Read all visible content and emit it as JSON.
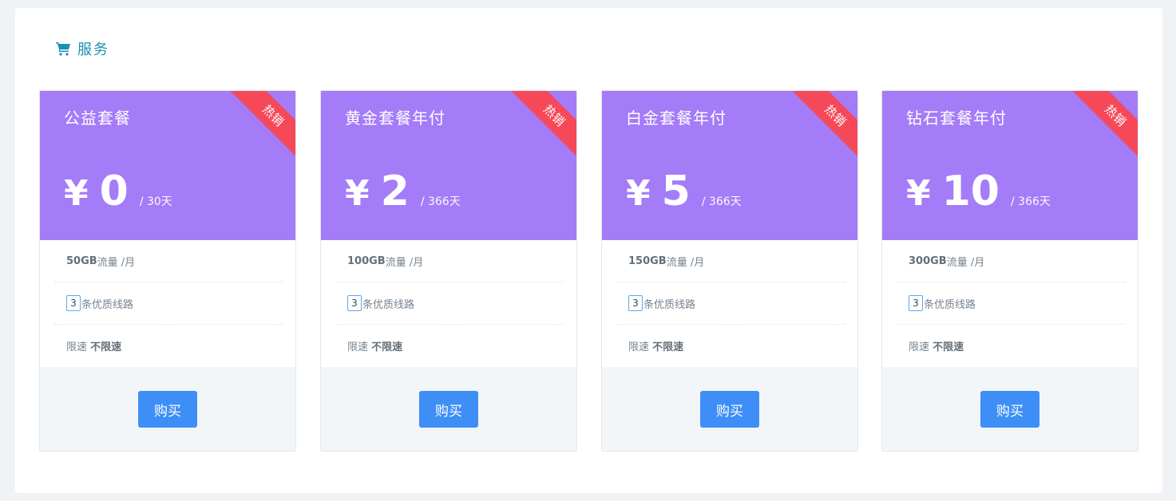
{
  "section": {
    "title": "服务",
    "icon": "shopping-cart-icon"
  },
  "colors": {
    "accent": "#1b8fb4",
    "card_head": "#a47cf7",
    "ribbon": "#f5495a",
    "button": "#3e8ef7"
  },
  "plans": [
    {
      "name": "公益套餐",
      "currency": "¥",
      "price": "0",
      "period": "/ 30天",
      "ribbon": "热销",
      "traffic_value": "50GB",
      "traffic_suffix": "流量 /月",
      "lines_count": "3",
      "lines_text": "条优质线路",
      "speed_label": "限速 ",
      "speed_value": "不限速",
      "buy_label": "购买"
    },
    {
      "name": "黄金套餐年付",
      "currency": "¥",
      "price": "2",
      "period": "/ 366天",
      "ribbon": "热销",
      "traffic_value": "100GB",
      "traffic_suffix": "流量 /月",
      "lines_count": "3",
      "lines_text": "条优质线路",
      "speed_label": "限速 ",
      "speed_value": "不限速",
      "buy_label": "购买"
    },
    {
      "name": "白金套餐年付",
      "currency": "¥",
      "price": "5",
      "period": "/ 366天",
      "ribbon": "热销",
      "traffic_value": "150GB",
      "traffic_suffix": "流量 /月",
      "lines_count": "3",
      "lines_text": "条优质线路",
      "speed_label": "限速 ",
      "speed_value": "不限速",
      "buy_label": "购买"
    },
    {
      "name": "钻石套餐年付",
      "currency": "¥",
      "price": "10",
      "period": "/ 366天",
      "ribbon": "热销",
      "traffic_value": "300GB",
      "traffic_suffix": "流量 /月",
      "lines_count": "3",
      "lines_text": "条优质线路",
      "speed_label": "限速 ",
      "speed_value": "不限速",
      "buy_label": "购买"
    }
  ]
}
